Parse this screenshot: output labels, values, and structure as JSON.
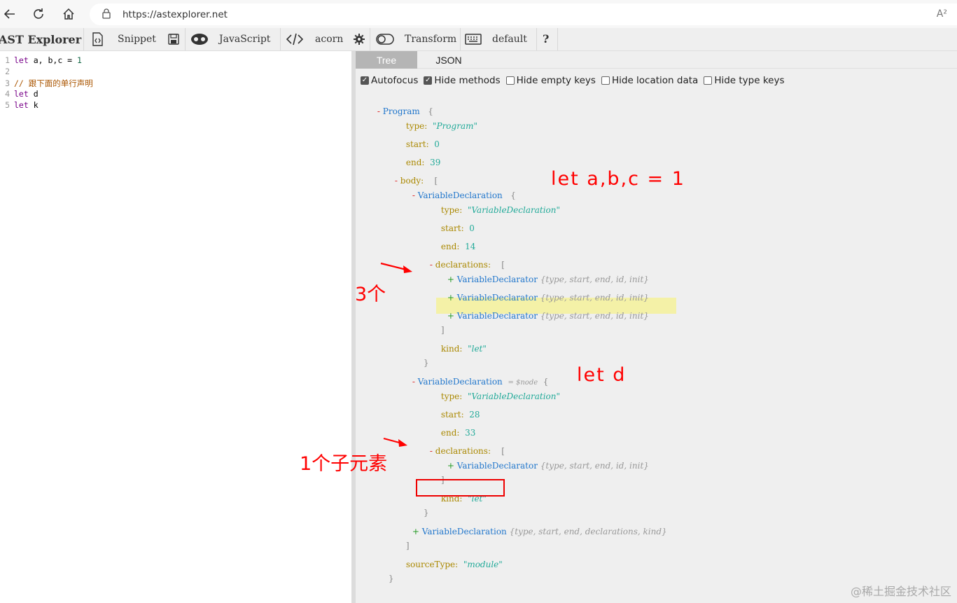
{
  "browser": {
    "url": "https://astexplorer.net",
    "read_aloud": "A²"
  },
  "toolbar": {
    "title": "AST Explorer",
    "snippet": "Snippet",
    "language": "JavaScript",
    "parser": "acorn",
    "transform": "Transform",
    "keymap": "default",
    "help": "?"
  },
  "editor": {
    "lines": [
      {
        "n": "1",
        "parts": [
          [
            "kw",
            "let"
          ],
          [
            "var",
            " a, b,c "
          ],
          [
            "op",
            "="
          ],
          [
            "num",
            " 1"
          ]
        ]
      },
      {
        "n": "2",
        "parts": []
      },
      {
        "n": "3",
        "parts": [
          [
            "cmt",
            "// 跟下面的单行声明"
          ]
        ]
      },
      {
        "n": "4",
        "parts": [
          [
            "kw",
            "let"
          ],
          [
            "var",
            " d"
          ]
        ]
      },
      {
        "n": "5",
        "parts": [
          [
            "kw",
            "let"
          ],
          [
            "var",
            " k"
          ]
        ]
      }
    ]
  },
  "tabs": {
    "tree": "Tree",
    "json": "JSON"
  },
  "options": [
    {
      "label": "Autofocus",
      "checked": true
    },
    {
      "label": "Hide methods",
      "checked": true
    },
    {
      "label": "Hide empty keys",
      "checked": false
    },
    {
      "label": "Hide location data",
      "checked": false
    },
    {
      "label": "Hide type keys",
      "checked": false
    }
  ],
  "tree": {
    "program": "Program",
    "type_key": "type:",
    "start_key": "start:",
    "end_key": "end:",
    "body_key": "body:",
    "declarations_key": "declarations:",
    "kind_key": "kind:",
    "sourceType_key": "sourceType:",
    "program_type": "\"Program\"",
    "program_start": "0",
    "program_end": "39",
    "var_decl": "VariableDeclaration",
    "var_decl_type": "\"VariableDeclaration\"",
    "decl1_start": "0",
    "decl1_end": "14",
    "declarator": "VariableDeclarator",
    "declarator_summary": "{type, start, end, id, init}",
    "kind_value": "\"let\"",
    "node_hint": "= $node",
    "decl2_start": "28",
    "decl2_end": "33",
    "decl3_summary": "{type, start, end, declarations, kind}",
    "sourceType_value": "\"module\"",
    "open_brace": "{",
    "close_brace": "}",
    "open_bracket": "[",
    "close_bracket": "]",
    "minus": "-",
    "plus": "+"
  },
  "annotations": {
    "decl1_note": "let a,b,c = 1",
    "three_note": "3个",
    "decl2_note": "let d",
    "one_child_note": "1个子元素"
  },
  "watermark": "@稀土掘金技术社区",
  "colors": {
    "annotation": "#ff0000",
    "highlight": "#f4f1a7"
  }
}
